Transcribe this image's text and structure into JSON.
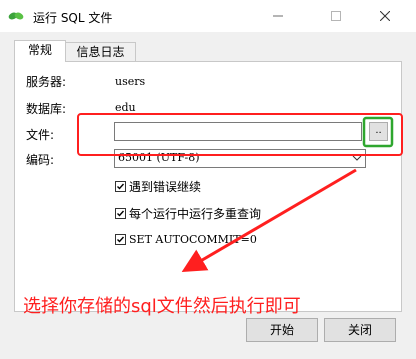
{
  "window": {
    "title": "运行 SQL 文件",
    "minimize_glyph": "—",
    "maximize_glyph": "☐",
    "close_glyph": "✕"
  },
  "tabs": [
    {
      "label": "常规",
      "active": true
    },
    {
      "label": "信息日志",
      "active": false
    }
  ],
  "form": {
    "server_label": "服务器:",
    "server_value": "users",
    "database_label": "数据库:",
    "database_value": "edu",
    "file_label": "文件:",
    "file_value": "",
    "browse_label": "..",
    "encoding_label": "编码:",
    "encoding_value": "65001 (UTF-8)"
  },
  "options": [
    {
      "label": "遇到错误继续",
      "checked": true
    },
    {
      "label": "每个运行中运行多重查询",
      "checked": true
    },
    {
      "label": "SET AUTOCOMMIT=0",
      "checked": true
    }
  ],
  "buttons": {
    "start": "开始",
    "close": "关闭"
  },
  "annotation": {
    "text": "选择你存储的sql文件然后执行即可",
    "color": "#ff1f1f",
    "highlight_color": "#2ea62e"
  },
  "icons": {
    "app": "sql-leaf-icon",
    "checkbox": "checkmark-icon",
    "dropdown": "chevron-down-icon"
  }
}
